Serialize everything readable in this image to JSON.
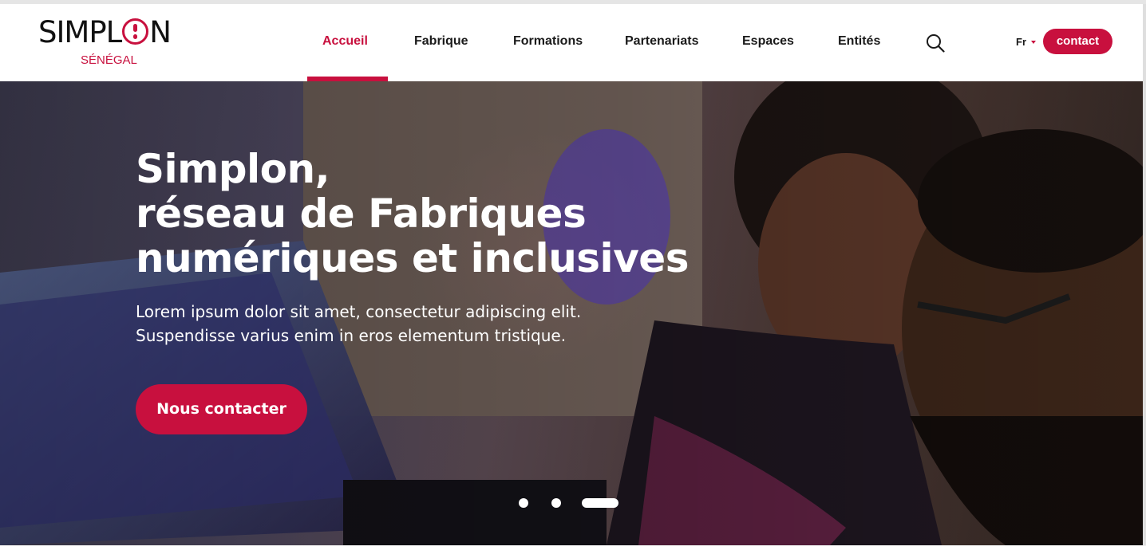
{
  "brand": {
    "name_part1": "SIMPL",
    "name_part2": "N",
    "subtitle": "SÉNÉGAL",
    "accent_color": "#c8103e"
  },
  "nav": {
    "items": [
      {
        "label": "Accueil",
        "active": true
      },
      {
        "label": "Fabrique",
        "active": false
      },
      {
        "label": "Formations",
        "active": false
      },
      {
        "label": "Partenariats",
        "active": false
      },
      {
        "label": "Espaces",
        "active": false
      },
      {
        "label": "Entités",
        "active": false
      }
    ],
    "search_icon": "search-icon",
    "language": "Fr",
    "contact_label": "contact"
  },
  "hero": {
    "title_lines": [
      "Simplon,",
      "réseau de Fabriques",
      "numériques et inclusives"
    ],
    "description_lines": [
      "Lorem ipsum dolor sit amet, consectetur adipiscing elit.",
      "Suspendisse varius enim in eros elementum tristique."
    ],
    "cta_label": "Nous contacter",
    "carousel": {
      "slide_count": 3,
      "active_slide": 3
    }
  }
}
